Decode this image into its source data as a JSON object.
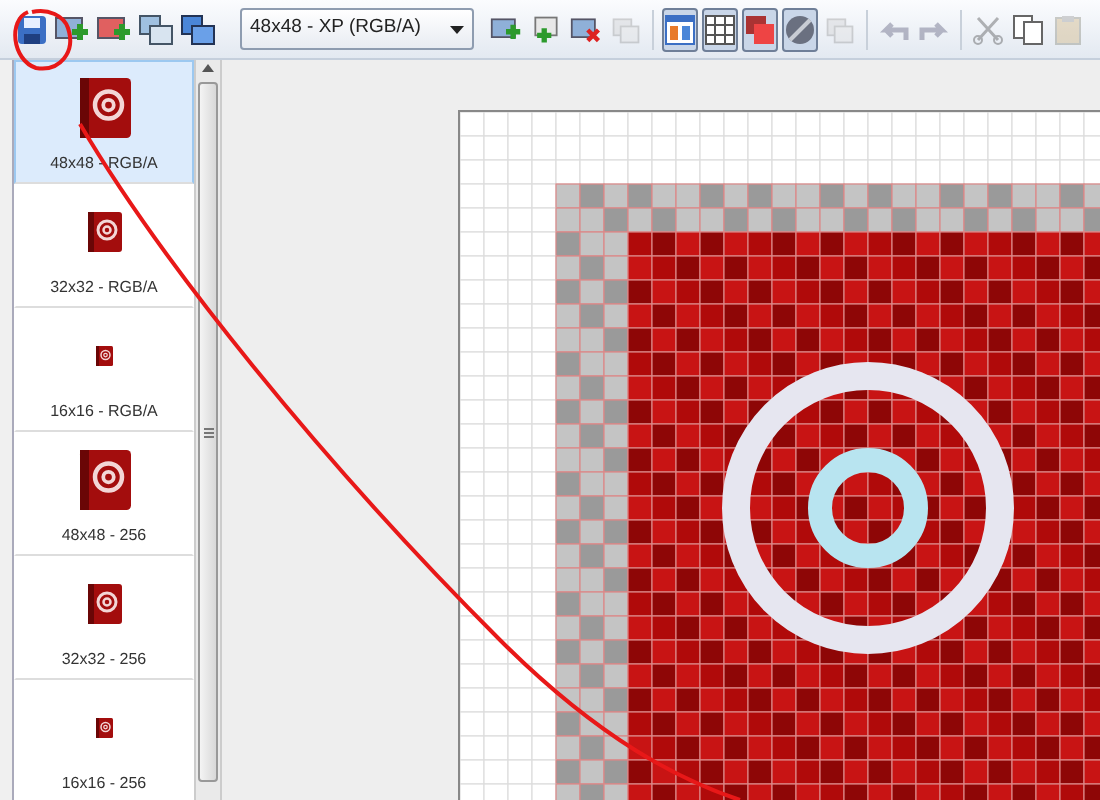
{
  "toolbar": {
    "left_buttons": [
      {
        "kind": "save",
        "disabled": false
      },
      {
        "kind": "add-image",
        "disabled": false
      },
      {
        "kind": "add-image-alt",
        "disabled": false
      },
      {
        "kind": "import",
        "disabled": false
      },
      {
        "kind": "duplicate",
        "disabled": false
      }
    ],
    "format_select": {
      "value": "48x48 - XP (RGB/A)"
    },
    "right_buttons": [
      {
        "kind": "add-image",
        "disabled": false,
        "pressed": false
      },
      {
        "kind": "add-layer",
        "disabled": false,
        "pressed": false
      },
      {
        "kind": "delete",
        "disabled": false,
        "pressed": false
      },
      {
        "kind": "layers",
        "disabled": true,
        "pressed": false
      },
      {
        "kind": "sep"
      },
      {
        "kind": "preview",
        "disabled": false,
        "pressed": true
      },
      {
        "kind": "grid",
        "disabled": false,
        "pressed": true
      },
      {
        "kind": "overlay",
        "disabled": false,
        "pressed": true
      },
      {
        "kind": "transparency",
        "disabled": false,
        "pressed": true
      },
      {
        "kind": "layers",
        "disabled": true,
        "pressed": false
      },
      {
        "kind": "sep"
      },
      {
        "kind": "undo",
        "disabled": true,
        "pressed": false
      },
      {
        "kind": "redo",
        "disabled": true,
        "pressed": false
      },
      {
        "kind": "sep"
      },
      {
        "kind": "cut",
        "disabled": true,
        "pressed": false
      },
      {
        "kind": "copy",
        "disabled": false,
        "pressed": false
      },
      {
        "kind": "paste",
        "disabled": true,
        "pressed": false
      }
    ]
  },
  "sidebar": {
    "items": [
      {
        "label": "48x48 - RGB/A",
        "kind": "large",
        "selected": true
      },
      {
        "label": "32x32 - RGB/A",
        "kind": "medium",
        "selected": false
      },
      {
        "label": "16x16 - RGB/A",
        "kind": "small",
        "selected": false
      },
      {
        "label": "48x48 - 256",
        "kind": "large",
        "selected": false
      },
      {
        "label": "32x32 - 256",
        "kind": "medium",
        "selected": false
      },
      {
        "label": "16x16 - 256",
        "kind": "small",
        "selected": false
      }
    ]
  },
  "annotation": {
    "visible": true
  }
}
